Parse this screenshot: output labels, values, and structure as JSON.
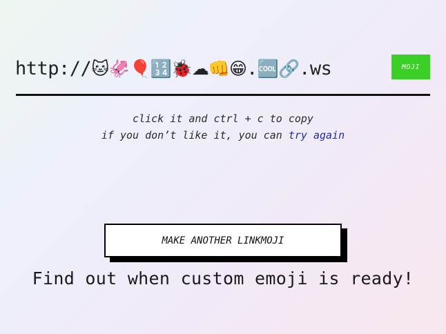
{
  "url": {
    "prefix": "http://",
    "emoji": "🐱🦑🎈🔢🐞☁👊😁",
    "dot": ".",
    "emoji_tld": "🆒🔗",
    "suffix": ".ws"
  },
  "moji_button": {
    "label": "MOJI"
  },
  "instructions": {
    "line1": "click it and ctrl + c to copy",
    "line2_prefix": "if you don’t like it, you can ",
    "try_again": "try again"
  },
  "make_another": {
    "label": "MAKE ANOTHER LINKMOJI"
  },
  "find_out": {
    "text": "Find out when custom emoji is ready!"
  },
  "colors": {
    "accent_green": "#3ccf28",
    "link_blue": "#1f2aa8"
  }
}
